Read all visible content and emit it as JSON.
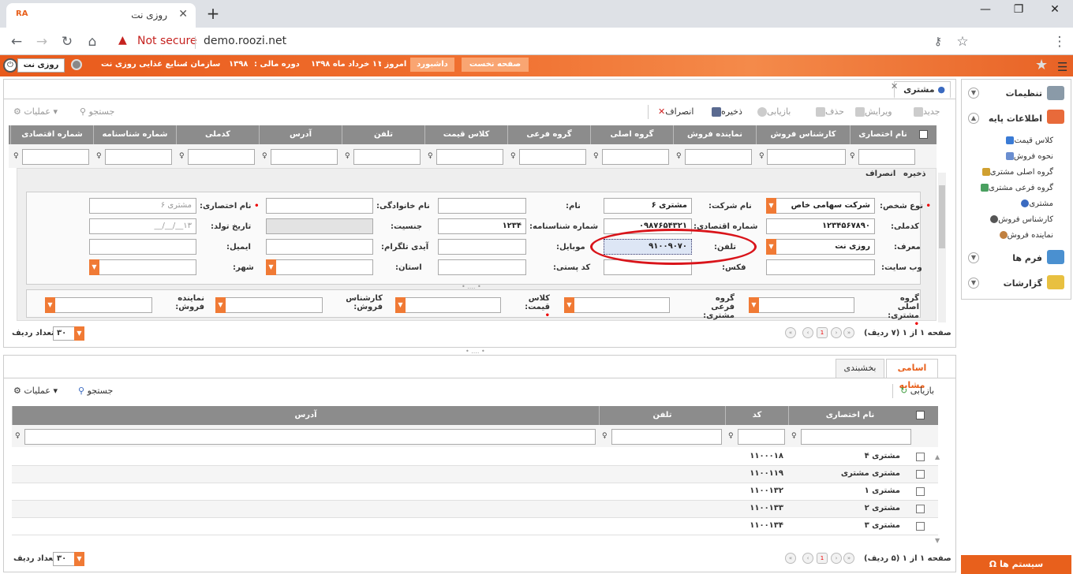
{
  "browser": {
    "tab_icon": "RA",
    "tab_title": "روزی نت",
    "not_secure": "Not secure",
    "url": "demo.roozi.net"
  },
  "appbar": {
    "user": "روزی نت",
    "org_label": "سازمان :",
    "org_value": "صنایع غذایی روزی نت",
    "fiscal_label": "دوره مالی :",
    "fiscal_value": "۱۳۹۸",
    "today_label": "امروز :",
    "today_value": "۱۱ خرداد ماه ۱۳۹۸",
    "dashboard": "داشبورد",
    "home": "صفحه نخست"
  },
  "nav": {
    "settings": "تنظیمات",
    "base_info": "اطلاعات پایه",
    "items": [
      "کلاس قیمت",
      "نحوه فروش",
      "گروه اصلی مشتری",
      "گروه فرعی مشتری",
      "مشتری",
      "کارشناس فروش",
      "نماینده فروش"
    ],
    "forms": "فرم ها",
    "reports": "گزارشات",
    "system": "سیستم ها"
  },
  "main": {
    "tab": "مشتری",
    "toolbar": {
      "new": "جدید",
      "edit": "ویرایش",
      "delete": "حذف",
      "refresh": "بازیابی",
      "save": "ذخیره",
      "cancel": "انصراف",
      "search": "جستجو",
      "actions": "عملیات"
    },
    "columns": [
      "نام اختصاری",
      "کارشناس فروش",
      "نماینده فروش",
      "گروه اصلی",
      "گروه فرعی",
      "کلاس قیمت",
      "تلفن",
      "آدرس",
      "کدملی",
      "شماره شناسنامه",
      "شماره اقتصادی"
    ],
    "inline_save": "ذخیره",
    "inline_cancel": "انصراف",
    "form": {
      "person_type_label": "نوع شخص:",
      "person_type_value": "شرکت سهامی خاص",
      "company_label": "نام شرکت:",
      "company_value": "مشتری ۶",
      "name_label": "نام:",
      "family_label": "نام خانوادگی:",
      "short_label": "نام اختصاری:",
      "short_placeholder": "مشتری ۶",
      "national_label": "کدملی:",
      "national_value": "۱۲۳۴۵۶۷۸۹۰",
      "economic_label": "شماره اقتصادی:",
      "economic_value": "۰۹۸۷۶۵۴۳۲۱",
      "id_no_label": "شماره شناسنامه:",
      "id_no_value": "۱۲۳۴",
      "gender_label": "جنسیت:",
      "birth_label": "تاریخ تولد:",
      "birth_placeholder": "۱۳__/__/__",
      "referrer_label": "معرف:",
      "referrer_value": "روزی نت",
      "phone_label": "تلفن:",
      "phone_value": "۹۱۰۰۹۰۷۰",
      "mobile_label": "موبایل:",
      "telegram_label": "آیدی تلگرام:",
      "email_label": "ایمیل:",
      "website_label": "وب سایت:",
      "fax_label": "فکس:",
      "postal_label": "کد پستی:",
      "province_label": "استان:",
      "city_label": "شهر:",
      "main_group_label": "گروه اصلی مشتری:",
      "sub_group_label": "گروه فرعی مشتری:",
      "price_class_label": "کلاس قیمت:",
      "sales_expert_label": "کارشناس فروش:",
      "sales_rep_label": "نماینده فروش:"
    },
    "pager": {
      "page_text": "صفحه ۱ از ۱ (۷ ردیف)",
      "page_num": "1",
      "row_count": "۳۰",
      "row_count_label": "تعداد ردیف"
    }
  },
  "lower": {
    "tabs": [
      "اسامی مشابه",
      "بخشبندی"
    ],
    "toolbar": {
      "refresh": "بازیابی",
      "search": "جستجو",
      "actions": "عملیات"
    },
    "columns": [
      "نام اختصاری",
      "کد",
      "تلفن",
      "آدرس"
    ],
    "rows": [
      {
        "name": "مشتری ۴",
        "code": "۱۱۰۰۰۱۸"
      },
      {
        "name": "مشتری مشتری",
        "code": "۱۱۰۰۱۱۹"
      },
      {
        "name": "مشتری ۱",
        "code": "۱۱۰۰۱۳۲"
      },
      {
        "name": "مشتری ۲",
        "code": "۱۱۰۰۱۳۳"
      },
      {
        "name": "مشتری ۳",
        "code": "۱۱۰۰۱۳۴"
      }
    ],
    "pager": {
      "page_text": "صفحه ۱ از ۱ (۵ ردیف)",
      "page_num": "1",
      "row_count": "۳۰",
      "row_count_label": "تعداد ردیف"
    }
  },
  "colors": {
    "accent": "#e8601c",
    "header_gray": "#8c8c8c",
    "highlight": "#d9141a"
  }
}
